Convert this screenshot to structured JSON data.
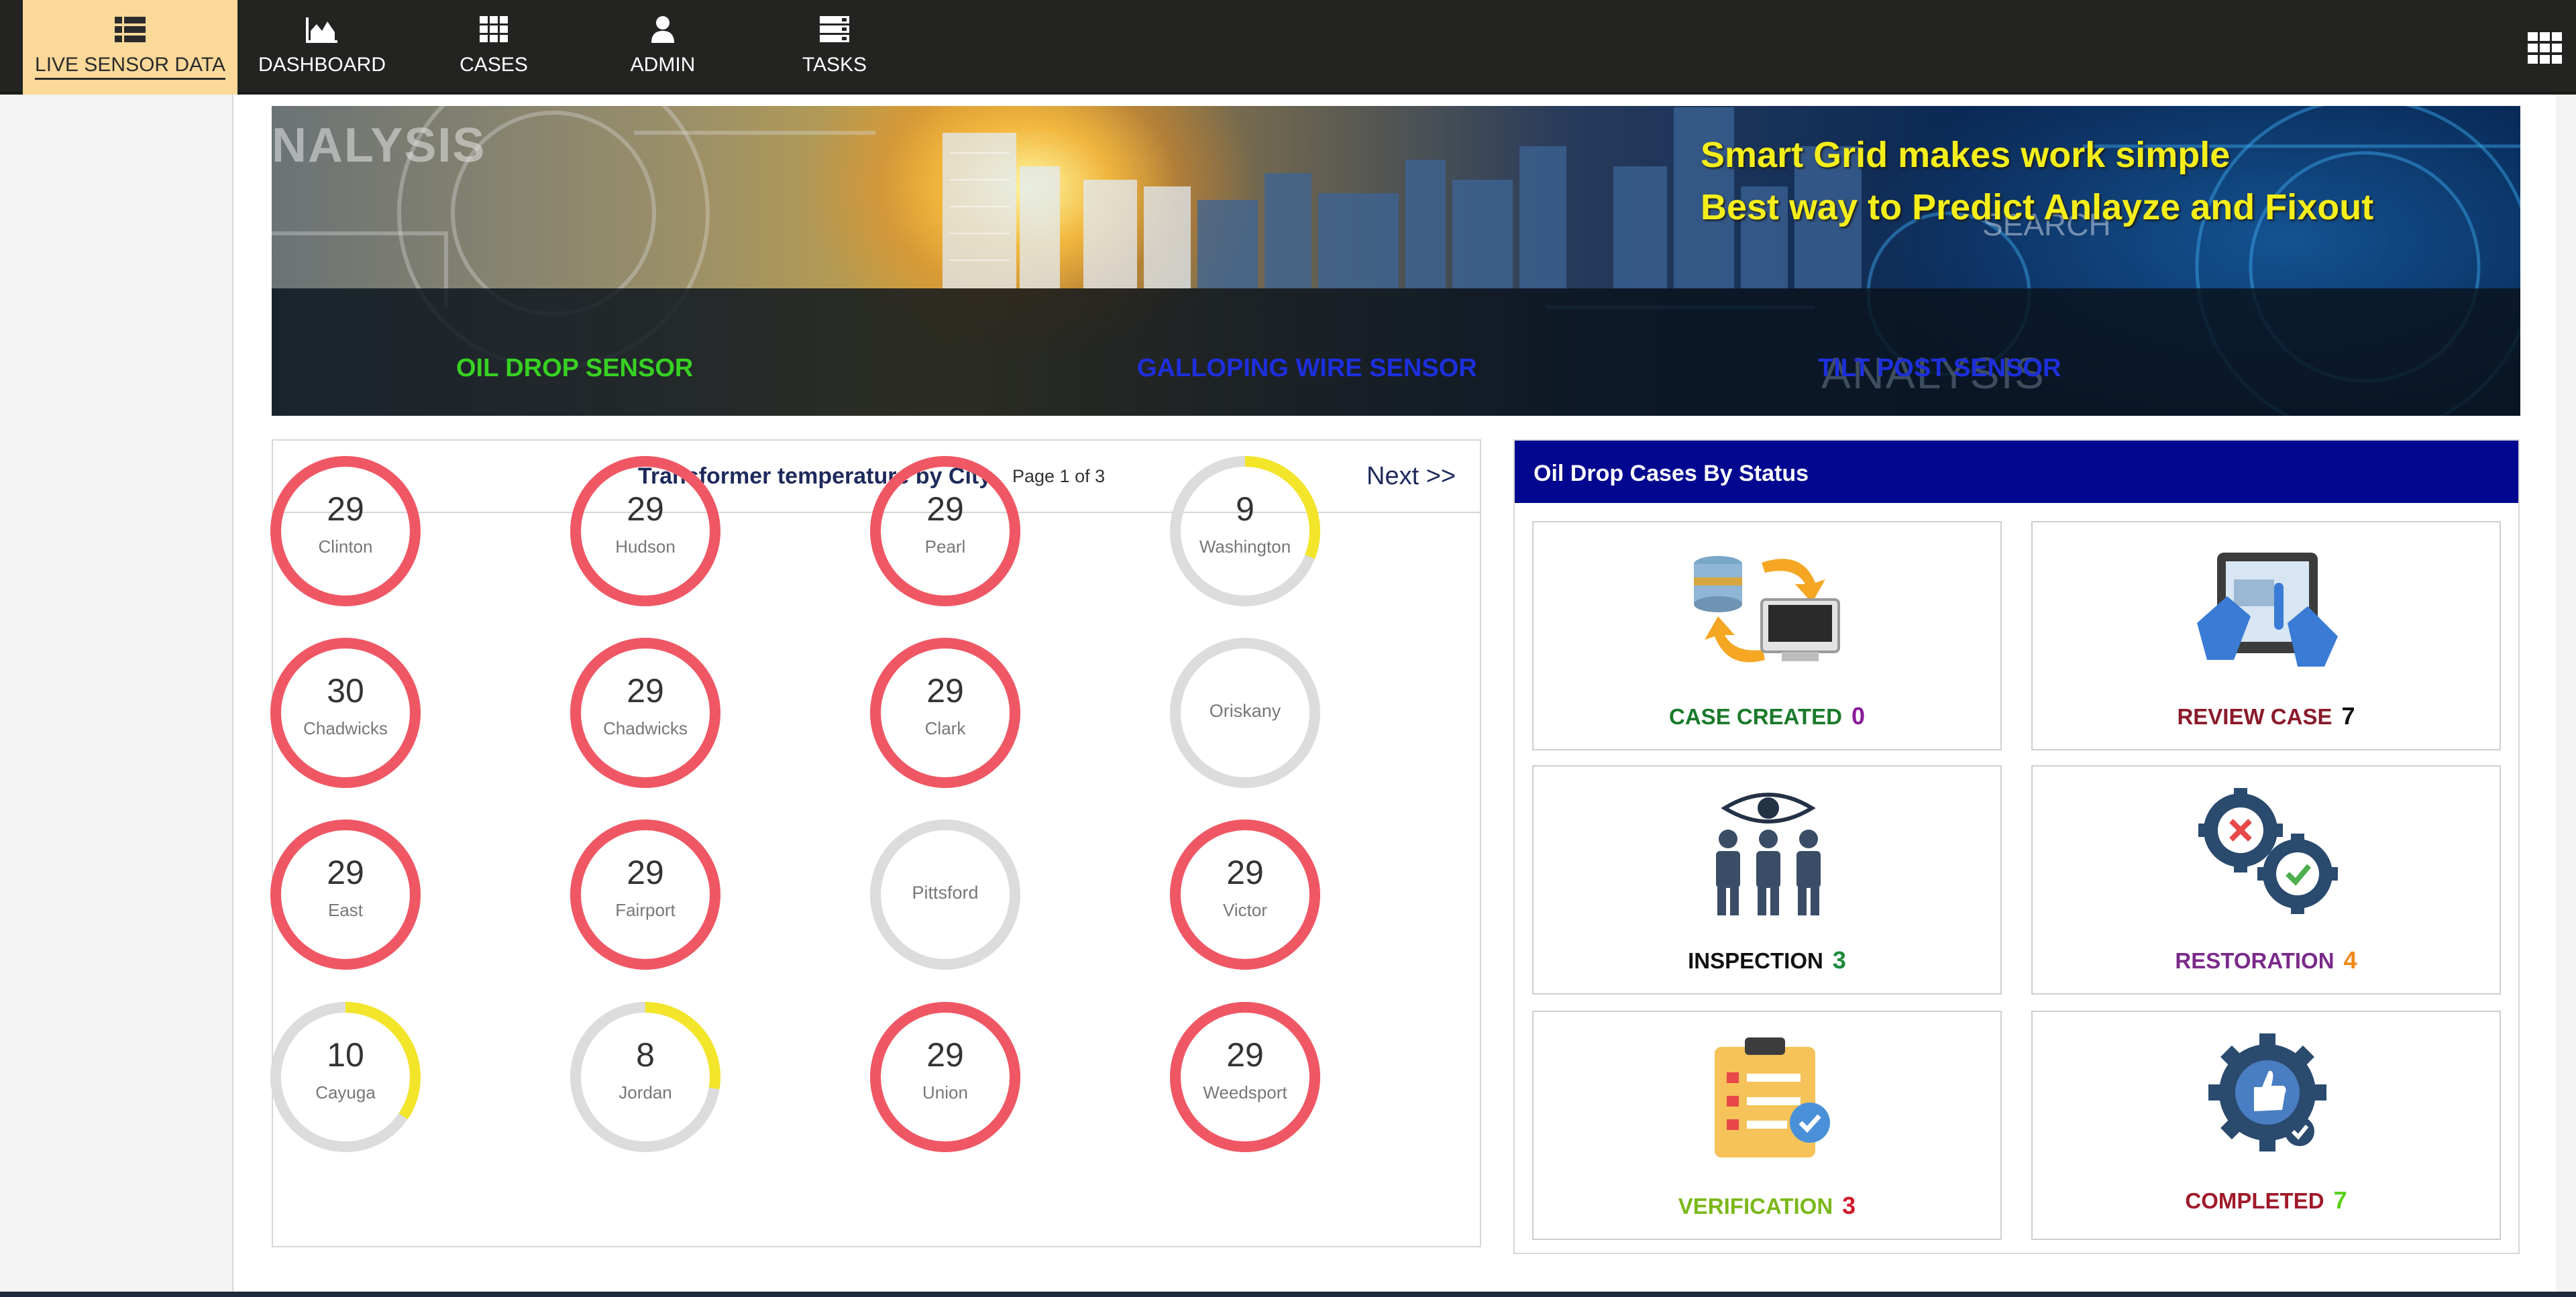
{
  "nav": {
    "items": [
      {
        "label": "LIVE SENSOR DATA",
        "icon": "table-list-icon",
        "active": true
      },
      {
        "label": "DASHBOARD",
        "icon": "area-chart-icon",
        "active": false
      },
      {
        "label": "CASES",
        "icon": "grid-icon",
        "active": false
      },
      {
        "label": "ADMIN",
        "icon": "user-icon",
        "active": false
      },
      {
        "label": "TASKS",
        "icon": "server-stack-icon",
        "active": false
      }
    ],
    "apps_icon": "apps-grid-icon"
  },
  "banner": {
    "slogan_line1": "Smart Grid makes work simple",
    "slogan_line2": "Best way to Predict Anlayze and Fixout",
    "watermark_left": "NALYSIS",
    "watermark_search": "SEARCH",
    "watermark_right": "ANALYSIS",
    "links": [
      {
        "label": "OIL DROP SENSOR",
        "color": "#37d122"
      },
      {
        "label": "GALLOPING WIRE SENSOR",
        "color": "#1d2fdc"
      },
      {
        "label": "TILT POST SENSOR",
        "color": "#1d2fdc"
      }
    ]
  },
  "temperature": {
    "title": "Transformer temperature by City",
    "page_text": "Page 1 of 3",
    "next_label": "Next >>",
    "max": 29,
    "colors": {
      "high": "#f05764",
      "low": "#f3e52a",
      "track": "#dcdcdc"
    },
    "cities": [
      {
        "value": "29",
        "city": "Clinton",
        "fraction": 1.0,
        "color": "high"
      },
      {
        "value": "29",
        "city": "Hudson",
        "fraction": 1.0,
        "color": "high"
      },
      {
        "value": "29",
        "city": "Pearl",
        "fraction": 1.0,
        "color": "high"
      },
      {
        "value": "9",
        "city": "Washington",
        "fraction": 0.31,
        "color": "low"
      },
      {
        "value": "30",
        "city": "Chadwicks",
        "fraction": 1.0,
        "color": "high"
      },
      {
        "value": "29",
        "city": "Chadwicks",
        "fraction": 1.0,
        "color": "high"
      },
      {
        "value": "29",
        "city": "Clark",
        "fraction": 1.0,
        "color": "high"
      },
      {
        "value": "",
        "city": "Oriskany",
        "fraction": 0,
        "color": "high"
      },
      {
        "value": "29",
        "city": "East",
        "fraction": 1.0,
        "color": "high"
      },
      {
        "value": "29",
        "city": "Fairport",
        "fraction": 1.0,
        "color": "high"
      },
      {
        "value": "",
        "city": "Pittsford",
        "fraction": 0,
        "color": "high"
      },
      {
        "value": "29",
        "city": "Victor",
        "fraction": 1.0,
        "color": "high"
      },
      {
        "value": "10",
        "city": "Cayuga",
        "fraction": 0.345,
        "color": "low"
      },
      {
        "value": "8",
        "city": "Jordan",
        "fraction": 0.276,
        "color": "low"
      },
      {
        "value": "29",
        "city": "Union",
        "fraction": 1.0,
        "color": "high"
      },
      {
        "value": "29",
        "city": "Weedsport",
        "fraction": 1.0,
        "color": "high"
      }
    ]
  },
  "cases": {
    "title": "Oil Drop Cases By Status",
    "items": [
      {
        "label": "CASE CREATED",
        "count": "0",
        "label_color": "#1a7a2a",
        "count_color": "#8a1a9a",
        "icon": "database-transfer-icon"
      },
      {
        "label": "REVIEW CASE",
        "count": "7",
        "label_color": "#8a1a2a",
        "count_color": "#111111",
        "icon": "tablet-touch-icon"
      },
      {
        "label": "INSPECTION",
        "count": "3",
        "label_color": "#111111",
        "count_color": "#1a8a3a",
        "icon": "eye-people-icon"
      },
      {
        "label": "RESTORATION",
        "count": "4",
        "label_color": "#7a2a8a",
        "count_color": "#f08a1a",
        "icon": "gears-check-icon"
      },
      {
        "label": "VERIFICATION",
        "count": "3",
        "label_color": "#7ab81a",
        "count_color": "#d01a2a",
        "icon": "clipboard-check-icon"
      },
      {
        "label": "COMPLETED",
        "count": "7",
        "label_color": "#a01a2a",
        "count_color": "#5ad11a",
        "icon": "gear-thumbs-up-icon"
      }
    ]
  }
}
